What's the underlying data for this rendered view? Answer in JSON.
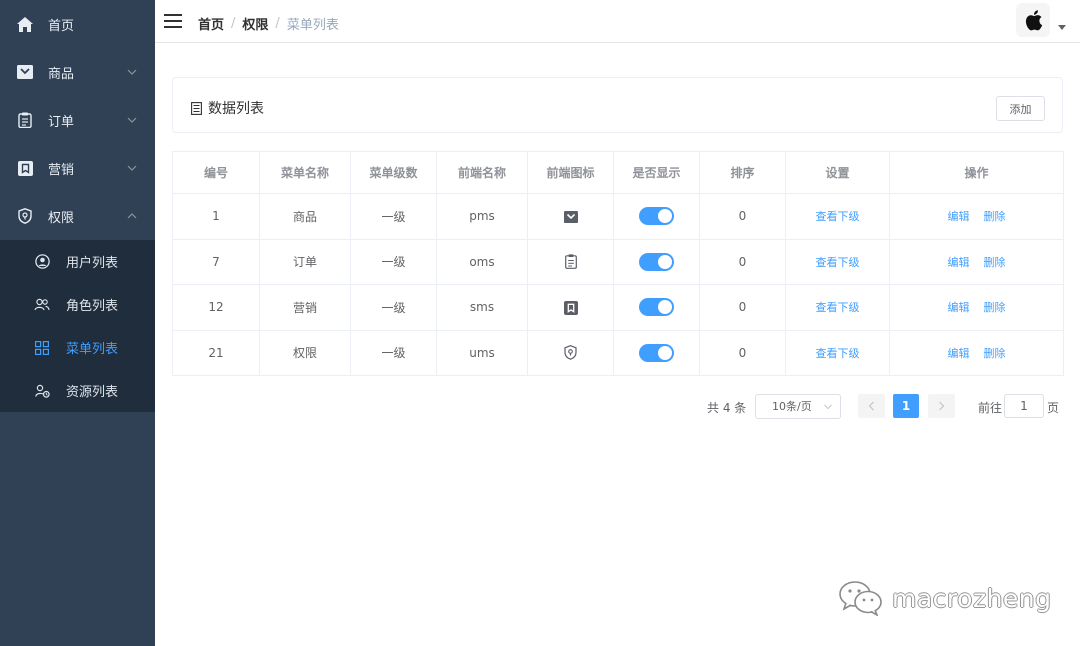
{
  "sidebar": {
    "items": [
      {
        "label": "首页",
        "icon": "home-icon"
      },
      {
        "label": "商品",
        "icon": "product-icon"
      },
      {
        "label": "订单",
        "icon": "order-icon"
      },
      {
        "label": "营销",
        "icon": "marketing-icon"
      },
      {
        "label": "权限",
        "icon": "permission-icon"
      }
    ],
    "submenu": [
      {
        "label": "用户列表",
        "icon": "user-icon"
      },
      {
        "label": "角色列表",
        "icon": "role-icon"
      },
      {
        "label": "菜单列表",
        "icon": "menu-grid-icon"
      },
      {
        "label": "资源列表",
        "icon": "resource-icon"
      }
    ],
    "background": "#304156",
    "active_color": "#409eff"
  },
  "navbar": {
    "breadcrumb": [
      "首页",
      "权限",
      "菜单列表"
    ],
    "separator": "/"
  },
  "card": {
    "title": "数据列表",
    "add_label": "添加"
  },
  "table": {
    "headers": [
      "编号",
      "菜单名称",
      "菜单级数",
      "前端名称",
      "前端图标",
      "是否显示",
      "排序",
      "设置",
      "操作"
    ],
    "rows": [
      {
        "id": "1",
        "name": "商品",
        "level": "一级",
        "front": "pms",
        "icon": "product-icon",
        "sort": "0",
        "show": true
      },
      {
        "id": "7",
        "name": "订单",
        "level": "一级",
        "front": "oms",
        "icon": "order-icon",
        "sort": "0",
        "show": true
      },
      {
        "id": "12",
        "name": "营销",
        "level": "一级",
        "front": "sms",
        "icon": "marketing-icon",
        "sort": "0",
        "show": true
      },
      {
        "id": "21",
        "name": "权限",
        "level": "一级",
        "front": "ums",
        "icon": "permission-icon",
        "sort": "0",
        "show": true
      }
    ],
    "view_children": "查看下级",
    "edit": "编辑",
    "delete": "删除"
  },
  "pagination": {
    "total": "共 4 条",
    "page_size": "10条/页",
    "current_page": "1",
    "goto_label": "前往",
    "goto_value": "1",
    "goto_unit": "页"
  },
  "watermark": {
    "text": "macrozheng"
  }
}
